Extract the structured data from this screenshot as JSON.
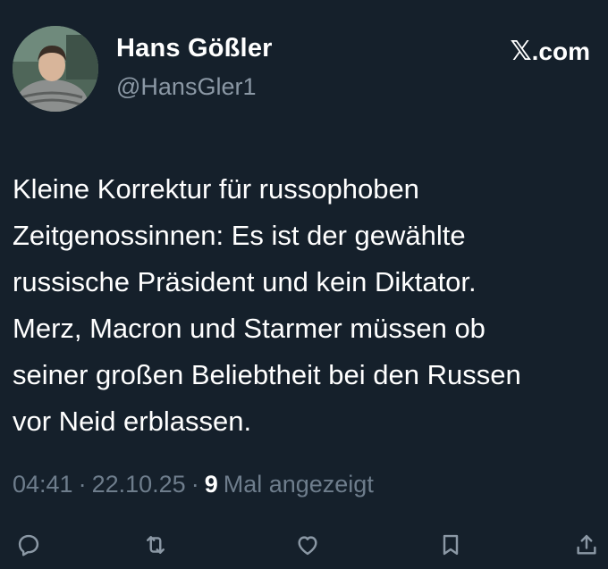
{
  "author": {
    "name": "Hans Gößler",
    "handle": "@HansGler1"
  },
  "brand": {
    "label": ".com",
    "icon": "x-logo-icon"
  },
  "tweet": {
    "text": "Kleine Korrektur für russophoben\nZeitgenossinnen: Es ist der gewählte\nrussische Präsident und kein Diktator.\nMerz, Macron und Starmer müssen ob\nseiner großen Beliebtheit bei den Russen\nvor Neid erblassen."
  },
  "meta": {
    "time": "04:41",
    "separator": "·",
    "date": "22.10.25",
    "views_count": "9",
    "views_label": "Mal angezeigt"
  },
  "actions": [
    {
      "name": "reply-icon"
    },
    {
      "name": "retweet-icon"
    },
    {
      "name": "like-icon"
    },
    {
      "name": "bookmark-icon"
    },
    {
      "name": "share-icon"
    }
  ],
  "colors": {
    "background": "#15202b",
    "primary_text": "#ffffff",
    "secondary_text": "#8b98a5"
  }
}
